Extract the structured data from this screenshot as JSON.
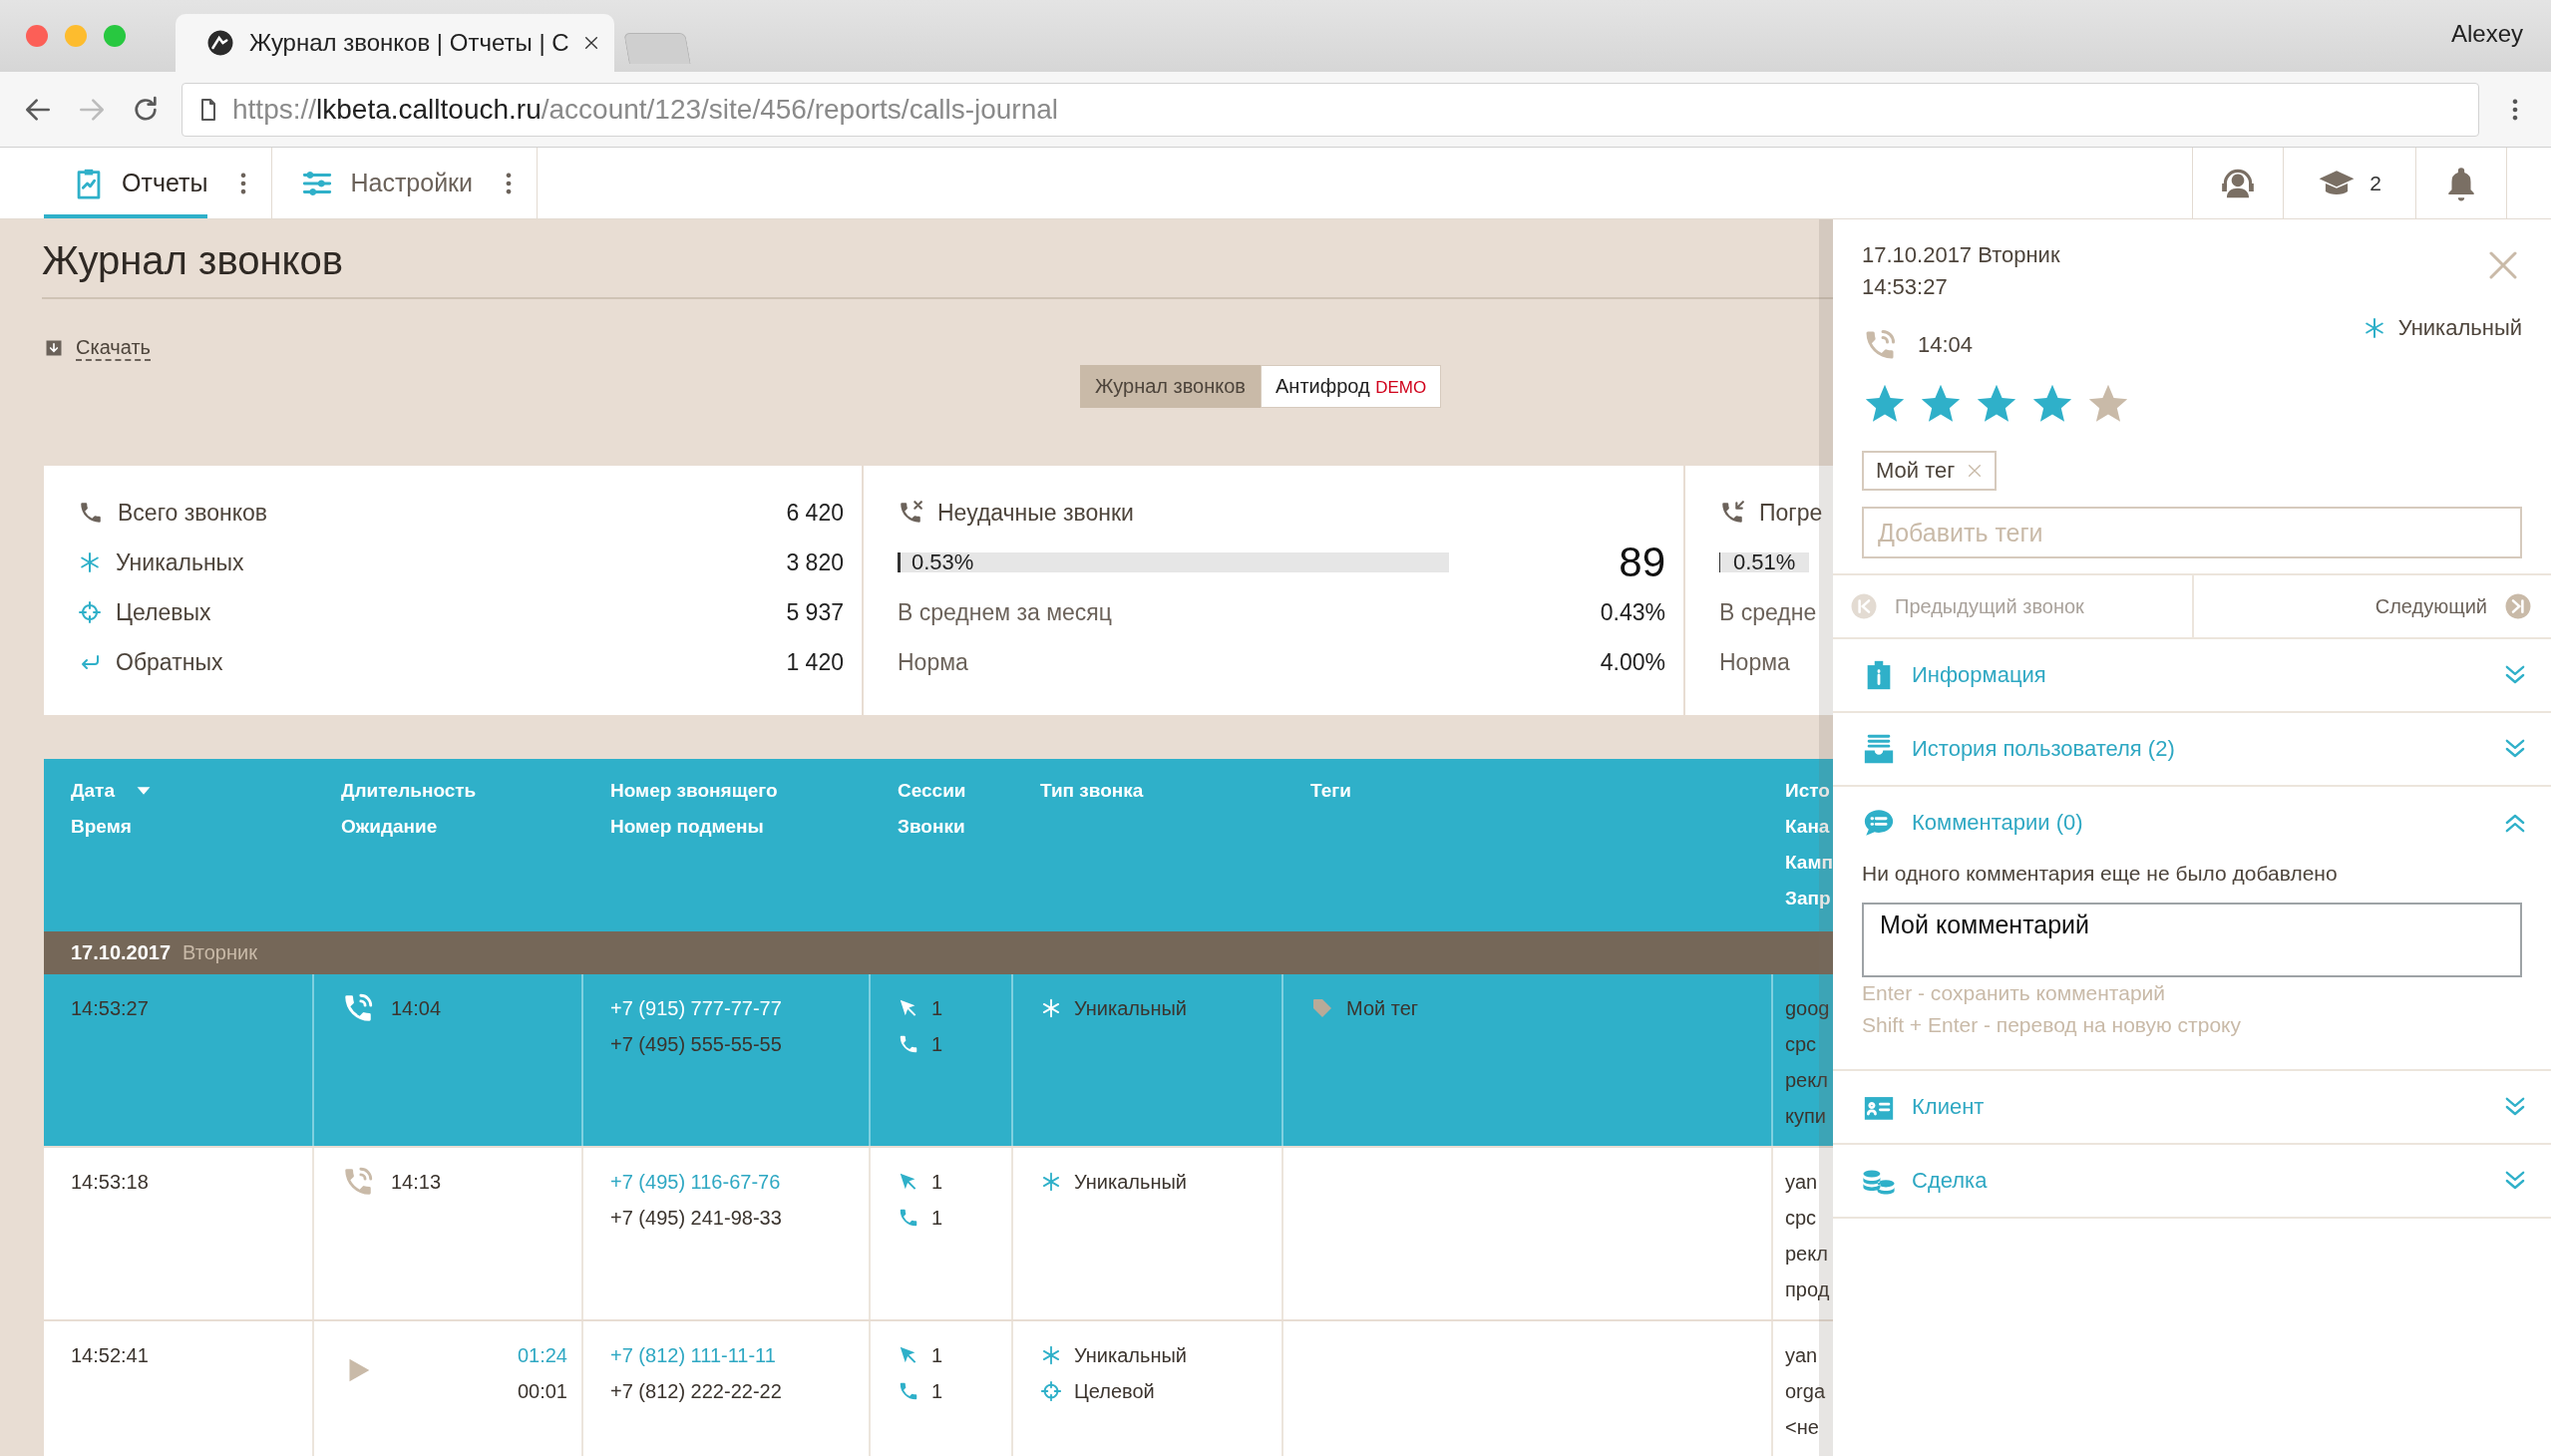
{
  "browser": {
    "tab_title": "Журнал звонков | Отчеты | C",
    "user": "Alexey",
    "url": {
      "scheme": "https://",
      "host": "lkbeta.calltouch.ru",
      "path": "/account/123/site/456/reports/calls-journal"
    }
  },
  "nav": {
    "tabs": [
      {
        "label": "Отчеты",
        "kind": "reports",
        "selected": true
      },
      {
        "label": "Настройки",
        "kind": "settings",
        "selected": false
      }
    ],
    "courses_count": "2"
  },
  "page": {
    "title": "Журнал звонков",
    "download": "Скачать",
    "views": [
      {
        "label": "Журнал звонков",
        "selected": true
      },
      {
        "label": "Антифрод",
        "tag": "DEMO",
        "selected": false
      }
    ]
  },
  "summary": [
    {
      "kind": "all",
      "label": "Всего звонков",
      "value": "6 420"
    },
    {
      "kind": "unique",
      "label": "Уникальных",
      "value": "3 820"
    },
    {
      "kind": "target",
      "label": "Целевых",
      "value": "5 937"
    },
    {
      "kind": "callback",
      "label": "Обратных",
      "value": "1 420"
    }
  ],
  "cards": [
    {
      "kind": "failed",
      "title": "Неудачные звонки",
      "share": "0.53%",
      "level": 0.0053,
      "count": "89",
      "rows": [
        {
          "label": "В среднем за месяц",
          "value": "0.43%"
        },
        {
          "label": "Норма",
          "value": "4.00%"
        }
      ]
    },
    {
      "kind": "lost",
      "title": "Погре",
      "share": "0.51%",
      "level": 0.0051,
      "rows": [
        {
          "label": "В средне"
        },
        {
          "label": "Норма"
        }
      ]
    }
  ],
  "table": {
    "columns": [
      {
        "lines": [
          "Дата",
          "Время"
        ],
        "sorted": true
      },
      {
        "lines": [
          "Длительность",
          "Ожидание"
        ]
      },
      {
        "lines": [
          "Номер звонящего",
          "Номер подмены"
        ]
      },
      {
        "lines": [
          "Сессии",
          "Звонки"
        ]
      },
      {
        "lines": [
          "Тип звонка"
        ]
      },
      {
        "lines": [
          "Теги"
        ]
      },
      {
        "lines": [
          "Исто",
          "Кана",
          "Камп",
          "Запр"
        ]
      }
    ],
    "group": {
      "date": "17.10.2017",
      "weekday": "Вторник"
    },
    "rows": [
      {
        "selected": true,
        "kind": "call",
        "time": "14:53:27",
        "duration": "14:04",
        "caller": "+7 (915) 777-77-77",
        "tracking": "+7 (495) 555-55-55",
        "sessions": "1",
        "calls": "1",
        "types": [
          {
            "kind": "unique",
            "label": "Уникальный"
          }
        ],
        "tags": [
          "Мой тег"
        ],
        "source": [
          "goog",
          "cpc",
          "рекл",
          "купи"
        ]
      },
      {
        "selected": false,
        "kind": "call",
        "time": "14:53:18",
        "duration": "14:13",
        "caller": "+7 (495) 116-67-76",
        "tracking": "+7 (495) 241-98-33",
        "sessions": "1",
        "calls": "1",
        "types": [
          {
            "kind": "unique",
            "label": "Уникальный"
          }
        ],
        "source": [
          "yan",
          "cpc",
          "рекл",
          "прод"
        ]
      },
      {
        "selected": false,
        "kind": "record",
        "time": "14:52:41",
        "duration": "01:24",
        "wait": "00:01",
        "caller": "+7 (812) 111-11-11",
        "tracking": "+7 (812) 222-22-22",
        "sessions": "1",
        "calls": "1",
        "types": [
          {
            "kind": "unique",
            "label": "Уникальный"
          },
          {
            "kind": "target",
            "label": "Целевой"
          }
        ],
        "source": [
          "yan",
          "orga",
          "<не"
        ]
      }
    ]
  },
  "panel": {
    "date": "17.10.2017 Вторник",
    "time": "14:53:27",
    "duration": "14:04",
    "type": {
      "kind": "unique",
      "label": "Уникальный"
    },
    "stars": 4,
    "tags": [
      "Мой тег"
    ],
    "tag_placeholder": "Добавить теги",
    "prev": {
      "label": "Предыдущий звонок",
      "disabled": true
    },
    "next": {
      "label": "Следующий",
      "disabled": false
    },
    "sections": [
      {
        "kind": "info",
        "title": "Информация",
        "expanded": false
      },
      {
        "kind": "history",
        "title": "История пользователя (2)",
        "expanded": false
      },
      {
        "kind": "comments",
        "title": "Комментарии (0)",
        "expanded": true,
        "empty_text": "Ни одного комментария еще не было добавлено",
        "comment": "Мой комментарий",
        "hints": [
          "Enter - сохранить комментарий",
          "Shift + Enter - перевод на новую строку"
        ]
      },
      {
        "kind": "client",
        "title": "Клиент",
        "expanded": false
      },
      {
        "kind": "deal",
        "title": "Сделка",
        "expanded": false
      }
    ]
  }
}
